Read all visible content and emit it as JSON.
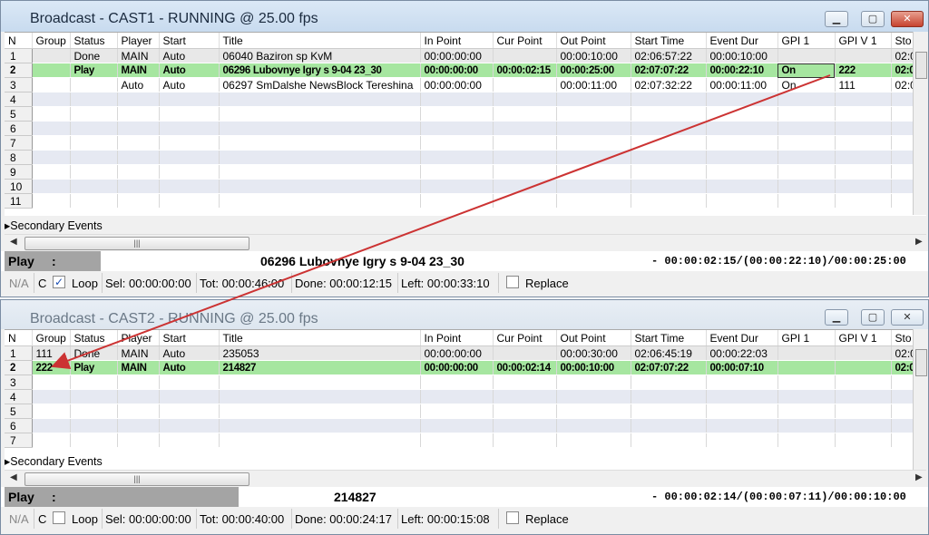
{
  "columns": [
    "N",
    "Group",
    "Status",
    "Player",
    "Start",
    "Title",
    "In Point",
    "Cur Point",
    "Out Point",
    "Start Time",
    "Event Dur",
    "GPI 1",
    "GPI V 1",
    "Sto"
  ],
  "win1": {
    "title": "Broadcast - CAST1 - RUNNING @ 25.00 fps",
    "rows": [
      {
        "n": "1",
        "group": "",
        "status": "Done",
        "player": "MAIN",
        "start": "Auto",
        "title": "06040 Baziron sp KvM",
        "in": "00:00:00:00",
        "cur": "",
        "out": "00:00:10:00",
        "stime": "02:06:57:22",
        "dur": "00:00:10:00",
        "gpi": "",
        "gpiv": "",
        "sto": "02:0"
      },
      {
        "n": "2",
        "group": "",
        "status": "Play",
        "player": "MAIN",
        "start": "Auto",
        "title": "06296 Lubovnye Igry s 9-04 23_30",
        "in": "00:00:00:00",
        "cur": "00:00:02:15",
        "out": "00:00:25:00",
        "stime": "02:07:07:22",
        "dur": "00:00:22:10",
        "gpi": "On",
        "gpiv": "222",
        "sto": "02:0"
      },
      {
        "n": "3",
        "group": "",
        "status": "",
        "player": "Auto",
        "start": "Auto",
        "title": "06297 SmDalshe NewsBlock Tereshina",
        "in": "00:00:00:00",
        "cur": "",
        "out": "00:00:11:00",
        "stime": "02:07:32:22",
        "dur": "00:00:11:00",
        "gpi": "On",
        "gpiv": "111",
        "sto": "02:0"
      },
      {
        "n": "4"
      },
      {
        "n": "5"
      },
      {
        "n": "6"
      },
      {
        "n": "7"
      },
      {
        "n": "8"
      },
      {
        "n": "9"
      },
      {
        "n": "10"
      },
      {
        "n": "11"
      }
    ],
    "secondary": "Secondary Events",
    "status_label": "Play",
    "status_colon": ":",
    "status_title": "06296 Lubovnye Igry s 9-04 23_30",
    "status_time": "- 00:00:02:15/(00:00:22:10)/00:00:25:00",
    "na": "N/A",
    "c": "C",
    "loop": "Loop",
    "loop_checked": true,
    "sel": "Sel: 00:00:00:00",
    "tot": "Tot: 00:00:46:00",
    "done": "Done: 00:00:12:15",
    "left": "Left: 00:00:33:10",
    "replace": "Replace"
  },
  "win2": {
    "title": "Broadcast - CAST2 - RUNNING @ 25.00 fps",
    "rows": [
      {
        "n": "1",
        "group": "111",
        "status": "Done",
        "player": "MAIN",
        "start": "Auto",
        "title": "235053",
        "in": "00:00:00:00",
        "cur": "",
        "out": "00:00:30:00",
        "stime": "02:06:45:19",
        "dur": "00:00:22:03",
        "gpi": "",
        "gpiv": "",
        "sto": "02:0"
      },
      {
        "n": "2",
        "group": "222",
        "status": "Play",
        "player": "MAIN",
        "start": "Auto",
        "title": "214827",
        "in": "00:00:00:00",
        "cur": "00:00:02:14",
        "out": "00:00:10:00",
        "stime": "02:07:07:22",
        "dur": "00:00:07:10",
        "gpi": "",
        "gpiv": "",
        "sto": "02:0"
      },
      {
        "n": "3"
      },
      {
        "n": "4"
      },
      {
        "n": "5"
      },
      {
        "n": "6"
      },
      {
        "n": "7"
      }
    ],
    "secondary": "Secondary Events",
    "status_label": "Play",
    "status_colon": ":",
    "status_title": "214827",
    "status_time": "- 00:00:02:14/(00:00:07:11)/00:00:10:00",
    "na": "N/A",
    "c": "C",
    "loop": "Loop",
    "loop_checked": false,
    "sel": "Sel: 00:00:00:00",
    "tot": "Tot: 00:00:40:00",
    "done": "Done: 00:00:24:17",
    "left": "Left: 00:00:15:08",
    "replace": "Replace"
  },
  "icons": {
    "minimize": "minimize-icon",
    "maximize": "maximize-icon",
    "close": "close-icon",
    "expand": "triangle-right-icon",
    "scroll_grip": "grip-icon"
  },
  "colors": {
    "play_row": "#a6e6a0",
    "alt_row": "#e6e9f2",
    "status_bar": "#a4a4a4",
    "arrow": "#cc3333"
  }
}
